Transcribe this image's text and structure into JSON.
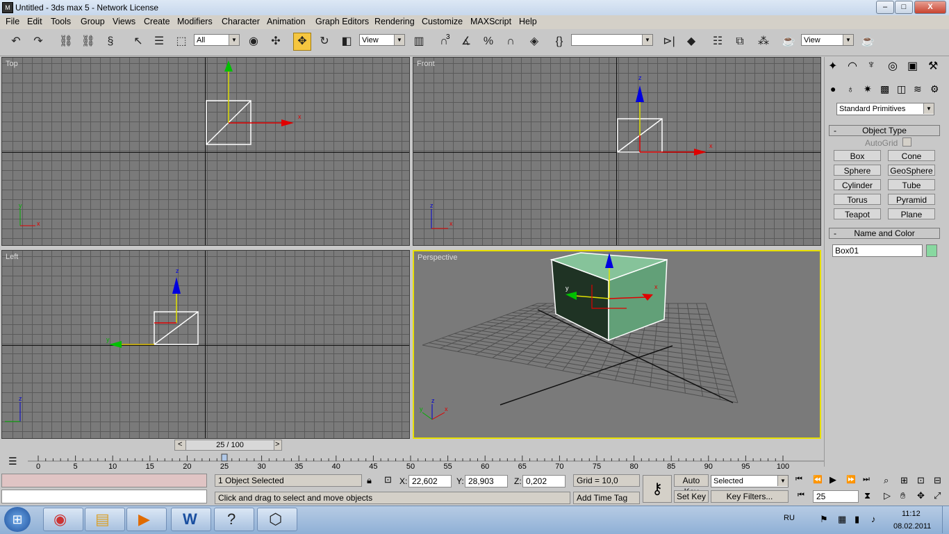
{
  "window": {
    "title": "Untitled - 3ds max 5 - Network License",
    "min": "–",
    "max": "□",
    "close": "X"
  },
  "menu": [
    "File",
    "Edit",
    "Tools",
    "Group",
    "Views",
    "Create",
    "Modifiers",
    "Character",
    "Animation",
    "Graph Editors",
    "Rendering",
    "Customize",
    "MAXScript",
    "Help"
  ],
  "toolbar": {
    "selection_filter": "All",
    "ref_coord": "View",
    "named_selection": "",
    "render_view": "View",
    "snap_three": "3"
  },
  "viewports": {
    "top": {
      "label": "Top"
    },
    "front": {
      "label": "Front"
    },
    "left": {
      "label": "Left"
    },
    "perspective": {
      "label": "Perspective"
    }
  },
  "axis": {
    "x": "x",
    "y": "y",
    "z": "z"
  },
  "command_panel": {
    "category": "Standard Primitives",
    "object_type_title": "Object Type",
    "autogrid": "AutoGrid",
    "buttons": [
      "Box",
      "Cone",
      "Sphere",
      "GeoSphere",
      "Cylinder",
      "Tube",
      "Torus",
      "Pyramid",
      "Teapot",
      "Plane"
    ],
    "name_color_title": "Name and Color",
    "object_name": "Box01",
    "object_color": "#88d8a0",
    "collapse": "-"
  },
  "time_slider": {
    "label": "25 / 100",
    "prev": "<",
    "next": ">",
    "current": 25
  },
  "timeline_ticks": [
    "0",
    "5",
    "10",
    "15",
    "20",
    "25",
    "30",
    "35",
    "40",
    "45",
    "50",
    "55",
    "60",
    "65",
    "70",
    "75",
    "80",
    "85",
    "90",
    "95",
    "100"
  ],
  "status": {
    "selected": "1 Object Selected",
    "prompt": "Click and drag to select and move objects",
    "x_label": "X:",
    "x": "22,602",
    "y_label": "Y:",
    "y": "28,903",
    "z_label": "Z:",
    "z": "0,202",
    "grid": "Grid = 10,0",
    "add_time_tag": "Add Time Tag",
    "auto_key": "Auto Key",
    "set_key": "Set Key",
    "key_mode": "Selected",
    "key_filters": "Key Filters...",
    "frame": "25"
  },
  "taskbar": {
    "lang": "RU",
    "time": "11:12",
    "date": "08.02.2011"
  },
  "colors": {
    "viewport_bg": "#7a7a7a",
    "grid": "#555555",
    "active_border": "#e8e000",
    "box_face": "#78b088"
  }
}
